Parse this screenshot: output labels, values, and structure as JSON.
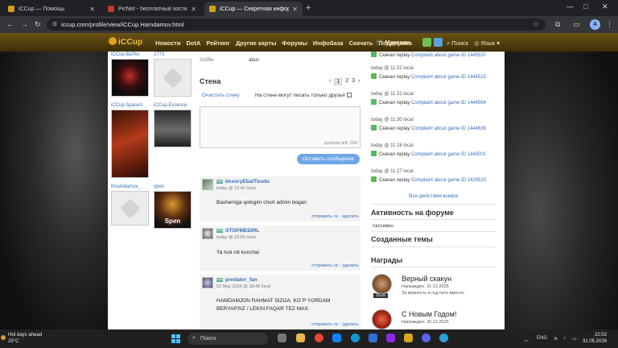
{
  "browser": {
    "tabs": [
      {
        "title": "iCCup — Помощь",
        "favicon_color": "#d4a017",
        "active": false
      },
      {
        "title": "PicNet - бесплатный хостинг",
        "favicon_color": "#c0392b",
        "active": false
      },
      {
        "title": "iCCup — Секретная информация",
        "favicon_color": "#d4a017",
        "active": true
      }
    ],
    "new_tab": "+",
    "url": "iccup.com/profile/view/iCCup.Hamdamov.html",
    "profile_initial": "A",
    "window_controls": [
      "—",
      "□",
      "✕"
    ]
  },
  "site": {
    "logo": "iCCup",
    "menu": [
      "Новости",
      "DotA",
      "Рейтинг",
      "Другие карты",
      "Форумы",
      "Инфобаза",
      "Скачать",
      "Поддержка"
    ],
    "shop": "Магазин",
    "search": "Поиск",
    "language": "Язык"
  },
  "friends": [
    {
      "name": "iCCup.Ba7ko",
      "pic": "dark"
    },
    {
      "name": "2772",
      "pic": "blank"
    },
    {
      "name": "iCCup.SpaceX",
      "pic": "red"
    },
    {
      "name": "iCCup.Essence",
      "pic": "car"
    },
    {
      "name": "Khamdamov_",
      "pic": "blank"
    },
    {
      "name": "spen",
      "pic": "spen",
      "pic_text": "Spen"
    }
  ],
  "profile": {
    "hobby_label": "Хобби",
    "hobby_value": "abus"
  },
  "wall": {
    "title": "Стена",
    "pages": [
      "‹",
      "1",
      "2",
      "3",
      "›"
    ],
    "clear_link": "Очистить стену",
    "everyone_label": "На стене могут писать только друзья",
    "symbols_left": "symbols left: 200",
    "post_button": "Оставить сообщение",
    "posts": [
      {
        "author": "ImsoryEbalTbudu",
        "time": "today @ 22:42 local",
        "text": "Bashernga qotogim chort admin bogan",
        "actions": "отправить лс · удалить"
      },
      {
        "author": "STOPMEDIRL",
        "time": "today @ 20:55 local",
        "text": "Ya tvoi rot konchal",
        "actions": "отправить лс · удалить"
      },
      {
        "author": "predator_fan",
        "time": "03 May 2026 @ 18:46 local",
        "text": "HAMDAMJON RAHMAT SIZGA. KO`P YORDAM BERYAPSIZ / LEKIN FAQAR TEZ MAS",
        "actions": "отправить лс · удалить"
      }
    ]
  },
  "activity": {
    "partial_row": {
      "prefix": "Скачал replay",
      "link": "Complaint about game ID 1445537"
    },
    "rows": [
      {
        "time": "today @ 11:32 local",
        "prefix": "Скачал replay",
        "link": "Complaint about game ID 1444515"
      },
      {
        "time": "today @ 11:31 local",
        "prefix": "Скачал replay",
        "link": "Complaint about game ID 1444564"
      },
      {
        "time": "today @ 11:30 local",
        "prefix": "Скачал replay",
        "link": "Complaint about game ID 1444639"
      },
      {
        "time": "today @ 11:28 local",
        "prefix": "Скачал replay",
        "link": "Complaint about game ID 1445001"
      },
      {
        "time": "today @ 11:27 local",
        "prefix": "Скачал replay",
        "link": "Complaint about game ID 1429510"
      }
    ],
    "all_actions": "Все действия юзера"
  },
  "forum": {
    "title": "Активность на форуме",
    "status": "пассивен"
  },
  "topics": {
    "title": "Созданные темы"
  },
  "awards": {
    "title": "Награды",
    "items": [
      {
        "name": "Верный скакун",
        "awarded": "Награжден: 31.12.2025",
        "desc": "За верность и год пути вместе.",
        "year": "2026"
      },
      {
        "name": "С Новым Годом!",
        "awarded": "Награжден: 30.12.2025"
      }
    ]
  },
  "taskbar": {
    "weather_title": "Hot days ahead",
    "weather_temp": "25°C",
    "search": "Поиск",
    "lang": "ENG",
    "time": "22:02",
    "date": "31.05.2026"
  }
}
